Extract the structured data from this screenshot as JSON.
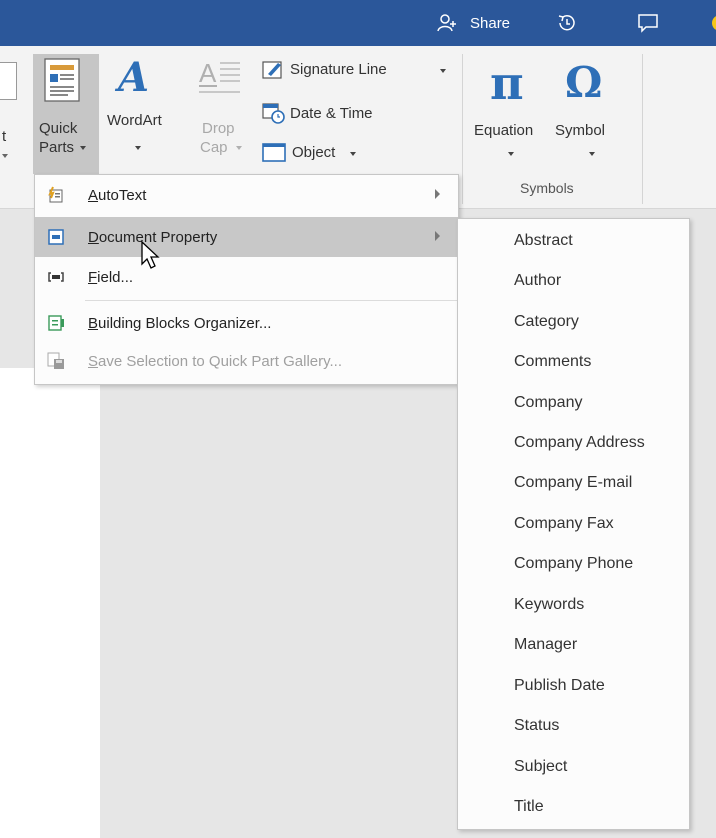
{
  "titlebar": {
    "share_label": "Share",
    "accent_color": "#2b579a"
  },
  "ribbon": {
    "quick_parts": {
      "line1": "Quick",
      "line2": "Parts"
    },
    "wordart": {
      "label": "WordArt"
    },
    "drop_cap": {
      "line1": "Drop",
      "line2": "Cap"
    },
    "signature_line": {
      "label": "Signature Line"
    },
    "date_time": {
      "label": "Date & Time"
    },
    "object": {
      "label": "Object"
    },
    "equation": {
      "label": "Equation"
    },
    "symbol": {
      "label": "Symbol"
    },
    "symbols_group_label": "Symbols",
    "partial_left": {
      "line1": "t"
    }
  },
  "quick_parts_menu": {
    "items": [
      {
        "label": "AutoText",
        "mnemonic": "A",
        "rest": "utoText",
        "icon": "autotext-icon",
        "has_submenu": true,
        "highlighted": false,
        "disabled": false
      },
      {
        "label": "Document Property",
        "mnemonic": "D",
        "rest": "ocument Property",
        "icon": "document-property-icon",
        "has_submenu": true,
        "highlighted": true,
        "disabled": false
      },
      {
        "label": "Field...",
        "mnemonic": "F",
        "rest": "ield...",
        "icon": "field-icon",
        "has_submenu": false,
        "highlighted": false,
        "disabled": false
      },
      {
        "label": "Building Blocks Organizer...",
        "mnemonic": "B",
        "rest": "uilding Blocks Organizer...",
        "icon": "building-blocks-icon",
        "has_submenu": false,
        "highlighted": false,
        "disabled": false
      },
      {
        "label": "Save Selection to Quick Part Gallery...",
        "mnemonic": "S",
        "rest": "ave Selection to Quick Part Gallery...",
        "icon": "save-selection-icon",
        "has_submenu": false,
        "highlighted": false,
        "disabled": true
      }
    ]
  },
  "document_property_submenu": {
    "items": [
      "Abstract",
      "Author",
      "Category",
      "Comments",
      "Company",
      "Company Address",
      "Company E-mail",
      "Company Fax",
      "Company Phone",
      "Keywords",
      "Manager",
      "Publish Date",
      "Status",
      "Subject",
      "Title"
    ]
  }
}
